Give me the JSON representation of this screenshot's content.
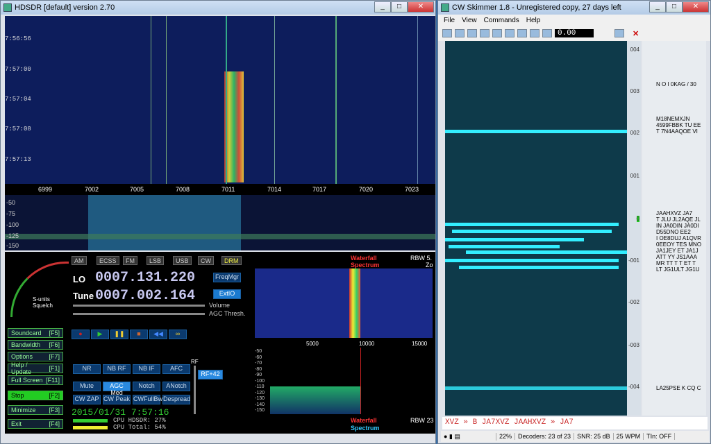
{
  "hdsdr": {
    "title": "HDSDR [default]  version 2.70",
    "timestamps": [
      "7:56:56",
      "7:57:00",
      "7:57:04",
      "7:57:08",
      "7:57:13"
    ],
    "freq_ticks": [
      "6999",
      "7002",
      "7005",
      "7008",
      "7011",
      "7014",
      "7017",
      "7020",
      "7023"
    ],
    "db_ticks": [
      "-50",
      "-75",
      "-100",
      "-125",
      "-150"
    ],
    "modes": [
      "AM",
      "ECSS",
      "FM",
      "LSB",
      "USB",
      "CW",
      "DRM"
    ],
    "lo_label": "LO",
    "lo_value": "0007.131.220",
    "tune_label": "Tune",
    "tune_value": "0007.002.164",
    "freqmgr": "FreqMgr",
    "extio": "ExtIO",
    "volume": "Volume",
    "agc_thresh": "AGC Thresh.",
    "smeter": "S-units Squelch",
    "left_buttons": [
      {
        "l": "Soundcard",
        "k": "[F5]"
      },
      {
        "l": "Bandwidth",
        "k": "[F6]"
      },
      {
        "l": "Options",
        "k": "[F7]"
      },
      {
        "l": "Help / Update",
        "k": "[F1]"
      },
      {
        "l": "Full Screen",
        "k": "[F11]"
      },
      {
        "l": "Stop",
        "k": "[F2]"
      },
      {
        "l": "Minimize",
        "k": "[F3]"
      },
      {
        "l": "Exit",
        "k": "[F4]"
      }
    ],
    "dsp": [
      "NR",
      "NB RF",
      "NB IF",
      "AFC",
      "Mute",
      "AGC Med",
      "Notch",
      "ANotch",
      "CW ZAP",
      "CW Peak",
      "CWFullBw",
      "Despread"
    ],
    "rf": "RF",
    "rf_value": "RF+42",
    "datetime": "2015/01/31  7:57:16",
    "cpu_hdsdr": "CPU HDSDR:  27%",
    "cpu_total": "CPU Total:  54%",
    "waterfall": "Waterfall",
    "spectrum": "Spectrum",
    "rbw1": "RBW  5.",
    "rbw2": "RBW 23",
    "zoom": "Zo",
    "af_ticks": [
      "5000",
      "10000",
      "15000"
    ],
    "af_db": [
      "-50",
      "-60",
      "-70",
      "-80",
      "-90",
      "-100",
      "-110",
      "-120",
      "-130",
      "-140",
      "-150"
    ]
  },
  "cw": {
    "title": "CW Skimmer 1.8 - Unregistered copy, 27 days left",
    "menu": [
      "File",
      "View",
      "Commands",
      "Help"
    ],
    "level": "0.00",
    "scale": [
      "004",
      "003",
      "002",
      "001",
      "0",
      "-001",
      "-002",
      "-003",
      "-004"
    ],
    "calls": [
      "N O I 0KAG / 30",
      "M18NEMXJN",
      "4599FBBK TU EE",
      "T 7N4AAQOE VI",
      "JAAHXVZ JA7",
      "T JLU JL2AQE JL",
      "IN JA0DIN JA0DI",
      "D55DNO EE2",
      "I OE8DUJ A1QVR",
      "0EEOY TES MNO",
      "JA1JEY ET JA1J",
      "ATT YY JS1AAA",
      "MR TT T T ET T",
      "LT JG1ULT JG1U",
      "LA25PSE K CQ C"
    ],
    "decode": "XVZ  »  B  JA7XVZ  JAAHXVZ  »  JA7",
    "status": [
      "22%",
      "Decoders: 23 of 23",
      "SNR: 25 dB",
      "25 WPM",
      "TIn: OFF"
    ]
  }
}
